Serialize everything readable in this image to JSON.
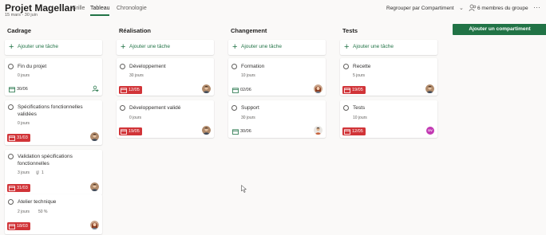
{
  "project": {
    "title": "Projet Magellan",
    "dates": "15 mars - 30 juin"
  },
  "tabs": [
    {
      "label": "Grille",
      "active": false
    },
    {
      "label": "Tableau",
      "active": true
    },
    {
      "label": "Chronologie",
      "active": false
    }
  ],
  "header": {
    "group_by": "Regrouper par Compartiment",
    "members": "6 membres du groupe",
    "more": "···"
  },
  "add_bucket": "Ajouter un compartiment",
  "add_task_label": "Ajouter une tâche",
  "colors": {
    "accent": "#217346",
    "overdue": "#d13438",
    "background": "#faf9f8"
  },
  "columns": [
    {
      "title": "Cadrage",
      "cards": [
        {
          "title": "Fin du projet",
          "progress": "0 jours",
          "date": "30/06",
          "overdue": false,
          "assignee": "assign-icon"
        },
        {
          "title": "Spécifications fonctionnelles validées",
          "progress": "0 jours",
          "date": "31/03",
          "overdue": true,
          "assignee": "avatar-man"
        },
        {
          "title": "Validation spécifications fonctionnelles",
          "progress": "3 jours",
          "attachments": "1",
          "date": "31/03",
          "overdue": true,
          "assignee": "avatar-man"
        },
        {
          "title": "Atelier technique",
          "progress": "2 jours",
          "percent": "50 %",
          "date": "18/03",
          "overdue": true,
          "assignee": "avatar-woman"
        }
      ]
    },
    {
      "title": "Réalisation",
      "cards": [
        {
          "title": "Développement",
          "progress": "30 jours",
          "date": "12/05",
          "overdue": true,
          "assignee": "avatar-man"
        },
        {
          "title": "Développement validé",
          "progress": "0 jours",
          "date": "19/05",
          "overdue": true,
          "assignee": "avatar-man"
        }
      ]
    },
    {
      "title": "Changement",
      "cards": [
        {
          "title": "Formation",
          "progress": "10 jours",
          "date": "02/06",
          "overdue": false,
          "assignee": "avatar-woman"
        },
        {
          "title": "Support",
          "progress": "30 jours",
          "date": "30/06",
          "overdue": false,
          "assignee": "avatar-man-2"
        }
      ]
    },
    {
      "title": "Tests",
      "cards": [
        {
          "title": "Recette",
          "progress": "5 jours",
          "date": "19/05",
          "overdue": true,
          "assignee": "avatar-man"
        },
        {
          "title": "Tests",
          "progress": "10 jours",
          "date": "12/05",
          "overdue": true,
          "assignee": "initials",
          "initials": "DV"
        }
      ]
    }
  ]
}
